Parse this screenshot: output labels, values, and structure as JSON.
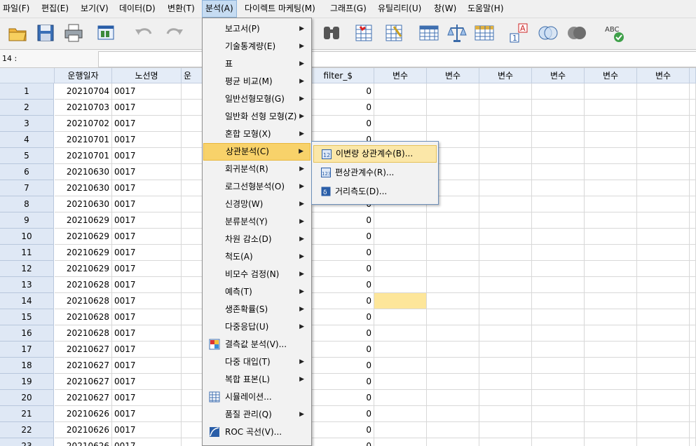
{
  "menubar": {
    "items": [
      {
        "label": "파일(F)",
        "key": "F"
      },
      {
        "label": "편집(E)",
        "key": "E"
      },
      {
        "label": "보기(V)",
        "key": "V"
      },
      {
        "label": "데이터(D)",
        "key": "D"
      },
      {
        "label": "변환(T)",
        "key": "T"
      },
      {
        "label": "분석(A)",
        "key": "A",
        "active": true
      },
      {
        "label": "다이렉트 마케팅(M)",
        "key": "M"
      },
      {
        "label": "그래프(G)",
        "key": "G"
      },
      {
        "label": "유틸리티(U)",
        "key": "U"
      },
      {
        "label": "창(W)",
        "key": "W"
      },
      {
        "label": "도움말(H)",
        "key": "H"
      }
    ]
  },
  "toolbar": {
    "icons": [
      "open-folder-icon",
      "save-icon",
      "print-icon",
      "dialog-recall-icon",
      "undo-icon",
      "redo-icon",
      "find-icon",
      "insert-cases-icon",
      "insert-variable-icon",
      "split-file-icon",
      "weight-cases-icon",
      "select-cases-icon",
      "value-labels-icon",
      "use-sets-icon",
      "show-all-variables-icon",
      "spell-check-icon"
    ]
  },
  "cellref": {
    "label": "14 :",
    "value": ""
  },
  "grid": {
    "headers": [
      "운행일자",
      "노선명",
      "운",
      "filter_$",
      "변수",
      "변수",
      "변수",
      "변수",
      "변수",
      "변수"
    ],
    "rows": [
      {
        "n": "1",
        "date": "20210704",
        "route": "0017",
        "filter": "0"
      },
      {
        "n": "2",
        "date": "20210703",
        "route": "0017",
        "filter": "0"
      },
      {
        "n": "3",
        "date": "20210702",
        "route": "0017",
        "filter": "0"
      },
      {
        "n": "4",
        "date": "20210701",
        "route": "0017",
        "filter": "0"
      },
      {
        "n": "5",
        "date": "20210701",
        "route": "0017",
        "filter": "0"
      },
      {
        "n": "6",
        "date": "20210630",
        "route": "0017",
        "filter": "0"
      },
      {
        "n": "7",
        "date": "20210630",
        "route": "0017",
        "filter": "0"
      },
      {
        "n": "8",
        "date": "20210630",
        "route": "0017",
        "filter": "0"
      },
      {
        "n": "9",
        "date": "20210629",
        "route": "0017",
        "filter": "0"
      },
      {
        "n": "10",
        "date": "20210629",
        "route": "0017",
        "filter": "0"
      },
      {
        "n": "11",
        "date": "20210629",
        "route": "0017",
        "filter": "0"
      },
      {
        "n": "12",
        "date": "20210629",
        "route": "0017",
        "filter": "0"
      },
      {
        "n": "13",
        "date": "20210628",
        "route": "0017",
        "filter": "0"
      },
      {
        "n": "14",
        "date": "20210628",
        "route": "0017",
        "filter": "0"
      },
      {
        "n": "15",
        "date": "20210628",
        "route": "0017",
        "filter": "0"
      },
      {
        "n": "16",
        "date": "20210628",
        "route": "0017",
        "filter": "0"
      },
      {
        "n": "17",
        "date": "20210627",
        "route": "0017",
        "filter": "0"
      },
      {
        "n": "18",
        "date": "20210627",
        "route": "0017",
        "filter": "0"
      },
      {
        "n": "19",
        "date": "20210627",
        "route": "0017",
        "filter": "0"
      },
      {
        "n": "20",
        "date": "20210627",
        "route": "0017",
        "filter": "0"
      },
      {
        "n": "21",
        "date": "20210626",
        "route": "0017",
        "filter": "0"
      },
      {
        "n": "22",
        "date": "20210626",
        "route": "0017",
        "filter": "0"
      },
      {
        "n": "23",
        "date": "20210626",
        "route": "0017",
        "filter": "0"
      }
    ]
  },
  "analyze_menu": {
    "items": [
      {
        "label": "보고서(P)",
        "submenu": true
      },
      {
        "label": "기술통계량(E)",
        "submenu": true
      },
      {
        "label": "표",
        "submenu": true
      },
      {
        "label": "평균 비교(M)",
        "submenu": true
      },
      {
        "label": "일반선형모형(G)",
        "submenu": true
      },
      {
        "label": "일반화 선형 모형(Z)",
        "submenu": true
      },
      {
        "label": "혼합 모형(X)",
        "submenu": true
      },
      {
        "label": "상관분석(C)",
        "submenu": true,
        "highlighted": true
      },
      {
        "label": "회귀분석(R)",
        "submenu": true
      },
      {
        "label": "로그선형분석(O)",
        "submenu": true
      },
      {
        "label": "신경망(W)",
        "submenu": true
      },
      {
        "label": "분류분석(Y)",
        "submenu": true
      },
      {
        "label": "차원 감소(D)",
        "submenu": true
      },
      {
        "label": "척도(A)",
        "submenu": true
      },
      {
        "label": "비모수 검정(N)",
        "submenu": true
      },
      {
        "label": "예측(T)",
        "submenu": true
      },
      {
        "label": "생존확률(S)",
        "submenu": true
      },
      {
        "label": "다중응답(U)",
        "submenu": true
      },
      {
        "label": "결측값 분석(V)...",
        "submenu": false,
        "icon": "missing-value-analysis-icon"
      },
      {
        "label": "다중 대입(T)",
        "submenu": true
      },
      {
        "label": "복합 표본(L)",
        "submenu": true
      },
      {
        "label": "시뮬레이션...",
        "submenu": false,
        "icon": "simulation-icon"
      },
      {
        "label": "품질 관리(Q)",
        "submenu": true
      },
      {
        "label": "ROC 곡선(V)...",
        "submenu": false,
        "icon": "roc-curve-icon"
      }
    ]
  },
  "correlate_submenu": {
    "items": [
      {
        "label": "이변량 상관계수(B)...",
        "icon": "bivariate-icon",
        "highlighted": true
      },
      {
        "label": "편상관계수(R)...",
        "icon": "partial-correlation-icon"
      },
      {
        "label": "거리측도(D)...",
        "icon": "distances-icon"
      }
    ]
  },
  "colors": {
    "menu_highlight": "#f8d26a",
    "selected_cell": "#fde69a",
    "header_bg": "#e4ecf7"
  }
}
